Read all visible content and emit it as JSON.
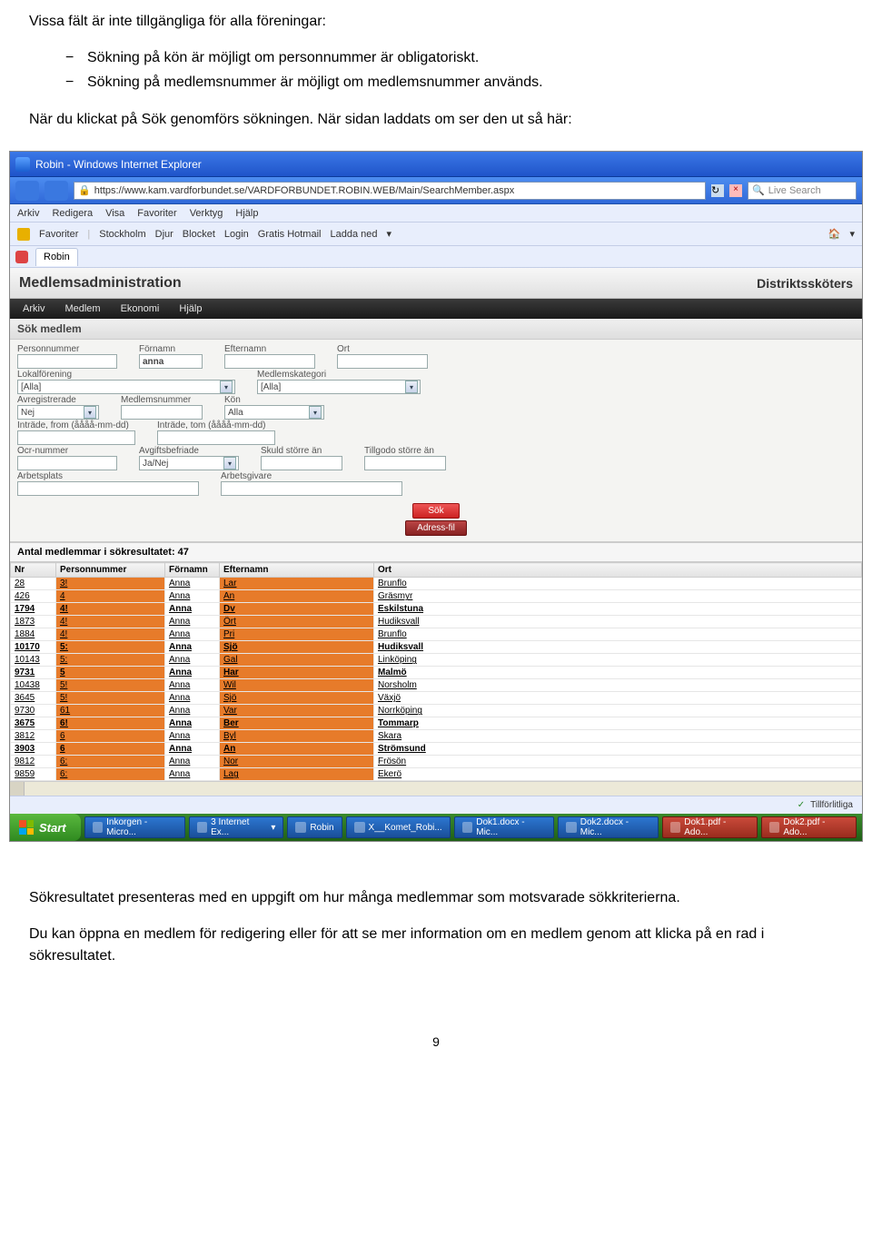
{
  "doc": {
    "intro": "Vissa fält är inte tillgängliga för alla föreningar:",
    "bullets": [
      "Sökning på kön är möjligt om personnummer är obligatoriskt.",
      "Sökning på medlemsnummer är möjligt om medlemsnummer används."
    ],
    "before_screenshot": "När du klickat på Sök genomförs sökningen. När sidan laddats om ser den ut så här:",
    "after_1": "Sökresultatet presenteras med en uppgift om hur många medlemmar som motsvarade sökkriterierna.",
    "after_2": "Du kan öppna en medlem för redigering eller för att se mer information om en medlem genom att klicka på en rad i sökresultatet.",
    "page_number": "9"
  },
  "window": {
    "title": "Robin - Windows Internet Explorer",
    "url": "https://www.kam.vardforbundet.se/VARDFORBUNDET.ROBIN.WEB/Main/SearchMember.aspx",
    "search_placeholder": "Live Search",
    "ie_menu": [
      "Arkiv",
      "Redigera",
      "Visa",
      "Favoriter",
      "Verktyg",
      "Hjälp"
    ],
    "fav_label": "Favoriter",
    "fav_items": [
      "Stockholm",
      "Djur",
      "Blocket",
      "Login",
      "Gratis Hotmail",
      "Ladda ned"
    ],
    "tab": "Robin",
    "page_title": "Medlemsadministration",
    "role": "Distriktssköters",
    "status_right": "Tillförlitliga"
  },
  "appmenu": [
    "Arkiv",
    "Medlem",
    "Ekonomi",
    "Hjälp"
  ],
  "search": {
    "panel_title": "Sök medlem",
    "fields": {
      "personnummer": {
        "label": "Personnummer",
        "value": ""
      },
      "fornamn": {
        "label": "Förnamn",
        "value": "anna"
      },
      "efternamn": {
        "label": "Efternamn",
        "value": ""
      },
      "ort": {
        "label": "Ort",
        "value": ""
      },
      "lokalforening": {
        "label": "Lokalförening",
        "value": "[Alla]"
      },
      "medlemskategori": {
        "label": "Medlemskategori",
        "value": "[Alla]"
      },
      "avregistrerade": {
        "label": "Avregistrerade",
        "value": "Nej"
      },
      "medlemsnummer": {
        "label": "Medlemsnummer",
        "value": ""
      },
      "kon": {
        "label": "Kön",
        "value": "Alla"
      },
      "intrade_from": {
        "label": "Inträde, from (åååå-mm-dd)",
        "value": ""
      },
      "intrade_tom": {
        "label": "Inträde, tom (åååå-mm-dd)",
        "value": ""
      },
      "ocrnummer": {
        "label": "Ocr-nummer",
        "value": ""
      },
      "avgiftsbefriade": {
        "label": "Avgiftsbefriade",
        "value": "Ja/Nej"
      },
      "skuld": {
        "label": "Skuld större än",
        "value": ""
      },
      "tillgodo": {
        "label": "Tillgodo större än",
        "value": ""
      },
      "arbetsplats": {
        "label": "Arbetsplats",
        "value": ""
      },
      "arbetsgivare": {
        "label": "Arbetsgivare",
        "value": ""
      }
    },
    "btn_search": "Sök",
    "btn_adress": "Adress-fil"
  },
  "results": {
    "count_label": "Antal medlemmar i sökresultatet: 47",
    "columns": [
      "Nr",
      "Personnummer",
      "Förnamn",
      "Efternamn",
      "Ort"
    ],
    "rows": [
      {
        "nr": "28",
        "pn": "3!",
        "fn": "Anna",
        "en": "Lar",
        "ort": "Brunflo",
        "bold": false
      },
      {
        "nr": "426",
        "pn": "4",
        "fn": "Anna",
        "en": "An",
        "ort": "Gräsmyr",
        "bold": false
      },
      {
        "nr": "1794",
        "pn": "4!",
        "fn": "Anna",
        "en": "Dv",
        "ort": "Eskilstuna",
        "bold": true
      },
      {
        "nr": "1873",
        "pn": "4!",
        "fn": "Anna",
        "en": "Ört",
        "ort": "Hudiksvall",
        "bold": false
      },
      {
        "nr": "1884",
        "pn": "4!",
        "fn": "Anna",
        "en": "Pri",
        "ort": "Brunflo",
        "bold": false
      },
      {
        "nr": "10170",
        "pn": "5:",
        "fn": "Anna",
        "en": "Sjö",
        "ort": "Hudiksvall",
        "bold": true
      },
      {
        "nr": "10143",
        "pn": "5:",
        "fn": "Anna",
        "en": "Gal",
        "ort": "Linköping",
        "bold": false
      },
      {
        "nr": "9731",
        "pn": "5",
        "fn": "Anna",
        "en": "Har",
        "ort": "Malmö",
        "bold": true
      },
      {
        "nr": "10438",
        "pn": "5!",
        "fn": "Anna",
        "en": "Wil",
        "ort": "Norsholm",
        "bold": false
      },
      {
        "nr": "3645",
        "pn": "5!",
        "fn": "Anna",
        "en": "Sjö",
        "ort": "Växjö",
        "bold": false
      },
      {
        "nr": "9730",
        "pn": "61",
        "fn": "Anna",
        "en": "Var",
        "ort": "Norrköping",
        "bold": false
      },
      {
        "nr": "3675",
        "pn": "6!",
        "fn": "Anna",
        "en": "Ber",
        "ort": "Tommarp",
        "bold": true
      },
      {
        "nr": "3812",
        "pn": "6",
        "fn": "Anna",
        "en": "Byl",
        "ort": "Skara",
        "bold": false
      },
      {
        "nr": "3903",
        "pn": "6",
        "fn": "Anna",
        "en": "An",
        "ort": "Strömsund",
        "bold": true
      },
      {
        "nr": "9812",
        "pn": "6:",
        "fn": "Anna",
        "en": "Nor",
        "ort": "Frösön",
        "bold": false
      },
      {
        "nr": "9859",
        "pn": "6:",
        "fn": "Anna",
        "en": "Lag",
        "ort": "Ekerö",
        "bold": false
      }
    ]
  },
  "taskbar": {
    "start": "Start",
    "items": [
      "Inkorgen - Micro...",
      "3 Internet Ex...",
      "Robin",
      "X__Komet_Robi...",
      "Dok1.docx - Mic...",
      "Dok2.docx - Mic...",
      "Dok1.pdf - Ado...",
      "Dok2.pdf - Ado..."
    ]
  }
}
